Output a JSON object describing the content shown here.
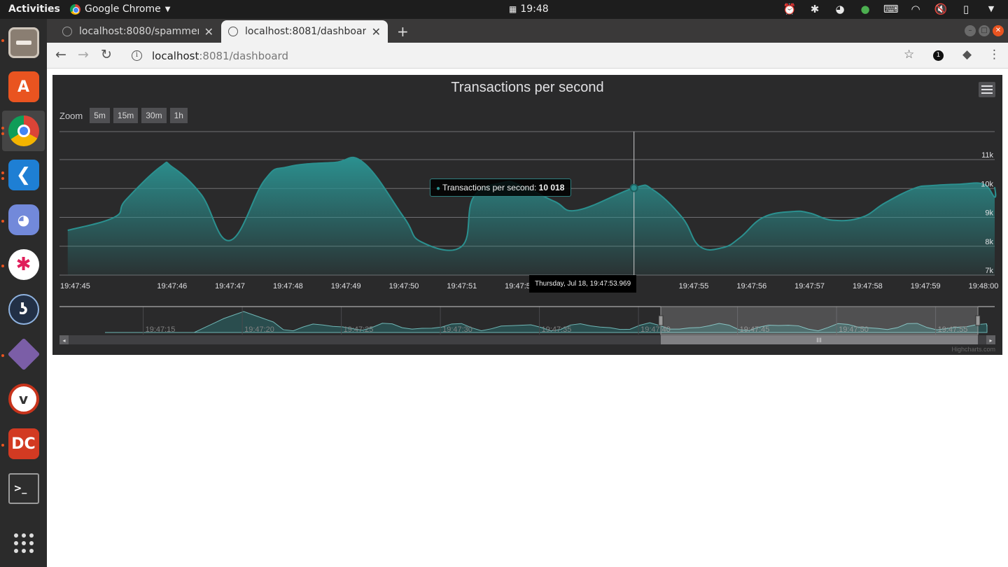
{
  "topbar": {
    "activities": "Activities",
    "app_menu": "Google Chrome",
    "clock": "19:48",
    "tray_icons": [
      "alarm-clock-icon",
      "slack-icon",
      "discord-icon",
      "color-icon",
      "keyboard-icon",
      "wifi-icon",
      "volume-mute-icon",
      "battery-icon",
      "power-menu-icon"
    ]
  },
  "dock": {
    "apps": [
      {
        "name": "files",
        "active": false
      },
      {
        "name": "software-center",
        "active": false
      },
      {
        "name": "chrome",
        "active": true
      },
      {
        "name": "vscode",
        "active": false
      },
      {
        "name": "discord",
        "active": false
      },
      {
        "name": "slack",
        "active": false
      },
      {
        "name": "kite",
        "active": false
      },
      {
        "name": "gitkraken",
        "active": false
      },
      {
        "name": "alarm-clock",
        "active": false
      },
      {
        "name": "double-commander",
        "active": false
      },
      {
        "name": "terminal",
        "active": false
      },
      {
        "name": "show-applications",
        "active": false
      }
    ]
  },
  "browser": {
    "tabs": [
      {
        "title": "localhost:8080/spammer?"
      },
      {
        "title": "localhost:8081/dashboard"
      }
    ],
    "url_host": "localhost",
    "url_rest": ":8081/dashboard"
  },
  "chart_area": {
    "zoom_label": "Zoom",
    "zoom_buttons": [
      "5m",
      "15m",
      "30m",
      "1h"
    ],
    "tooltip_series": "Transactions per second: ",
    "tooltip_value": "10 018",
    "tooltip_time": "Thursday, Jul 18, 19:47:53.969",
    "credits": "Highcharts.com",
    "colors": {
      "series": "#2b908f",
      "background": "#2a2a2b"
    }
  },
  "chart_data": {
    "type": "area",
    "title": "Transactions per second",
    "x_ticks": [
      "19:47:45",
      "19:47:46",
      "19:47:47",
      "19:47:48",
      "19:47:49",
      "19:47:50",
      "19:47:51",
      "19:47:52",
      "19:47:53",
      "19:47:55",
      "19:47:56",
      "19:47:57",
      "19:47:58",
      "19:47:59",
      "19:48:00"
    ],
    "y_ticks": [
      "7k",
      "8k",
      "9k",
      "10k",
      "11k"
    ],
    "ylim": [
      7000,
      11000
    ],
    "x": [
      44.2,
      45.0,
      45.2,
      45.8,
      46.0,
      46.5,
      47.0,
      47.6,
      48.0,
      48.8,
      49.3,
      50.0,
      50.3,
      51.0,
      51.2,
      51.7,
      52.0,
      52.6,
      53.0,
      53.97,
      54.3,
      54.8,
      55.1,
      55.5,
      55.8,
      56.2,
      56.7,
      57.0,
      57.4,
      57.9,
      58.3,
      58.8,
      59.1,
      59.6,
      60.0,
      60.4,
      61.1
    ],
    "series": [
      {
        "name": "Transactions per second",
        "values": [
          8550,
          9000,
          9600,
          10750,
          10750,
          9800,
          8200,
          10300,
          10750,
          10900,
          10900,
          9000,
          8150,
          8000,
          9700,
          10200,
          10120,
          9550,
          9250,
          10018,
          9950,
          9000,
          8000,
          7950,
          8300,
          9000,
          9200,
          9150,
          8900,
          9000,
          9500,
          10000,
          10100,
          10150,
          10150,
          9700,
          10050
        ]
      }
    ],
    "navigator": {
      "x_ticks": [
        "19:47:15",
        "19:47:20",
        "19:47:25",
        "19:47:30",
        "19:47:35",
        "19:47:40",
        "19:47:45",
        "19:47:50",
        "19:47:55",
        "19:48:00"
      ]
    }
  }
}
